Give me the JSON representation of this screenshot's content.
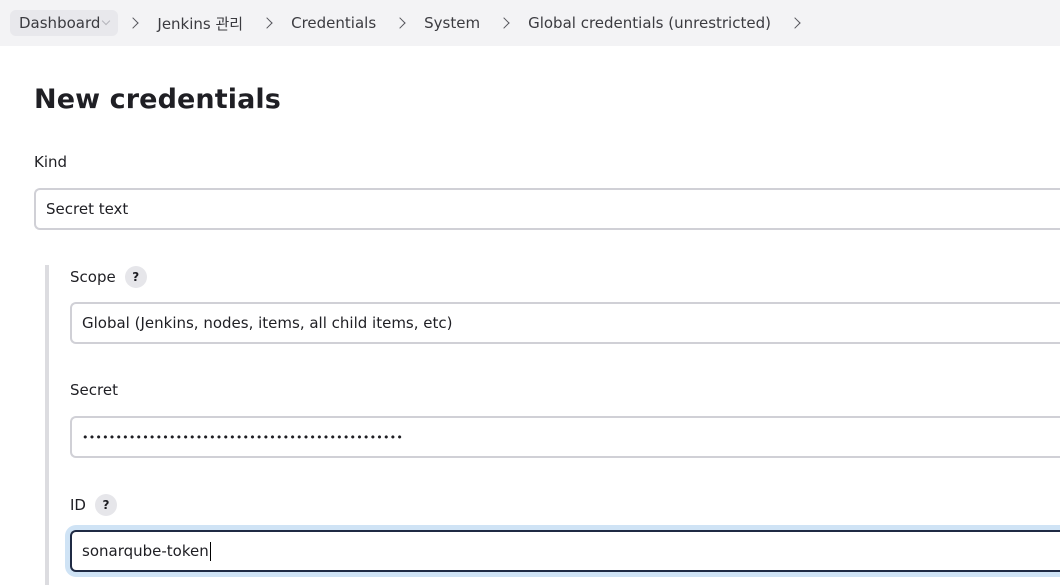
{
  "breadcrumb": {
    "items": [
      {
        "label": "Dashboard"
      },
      {
        "label": "Jenkins 관리"
      },
      {
        "label": "Credentials"
      },
      {
        "label": "System"
      },
      {
        "label": "Global credentials (unrestricted)"
      }
    ]
  },
  "page": {
    "title": "New credentials"
  },
  "form": {
    "kind": {
      "label": "Kind",
      "value": "Secret text"
    },
    "scope": {
      "label": "Scope",
      "help": "?",
      "value": "Global (Jenkins, nodes, items, all child items, etc)"
    },
    "secret": {
      "label": "Secret",
      "value": "••••••••••••••••••••••••••••••••••••••••••••••••"
    },
    "id": {
      "label": "ID",
      "help": "?",
      "value": "sonarqube-token"
    }
  }
}
